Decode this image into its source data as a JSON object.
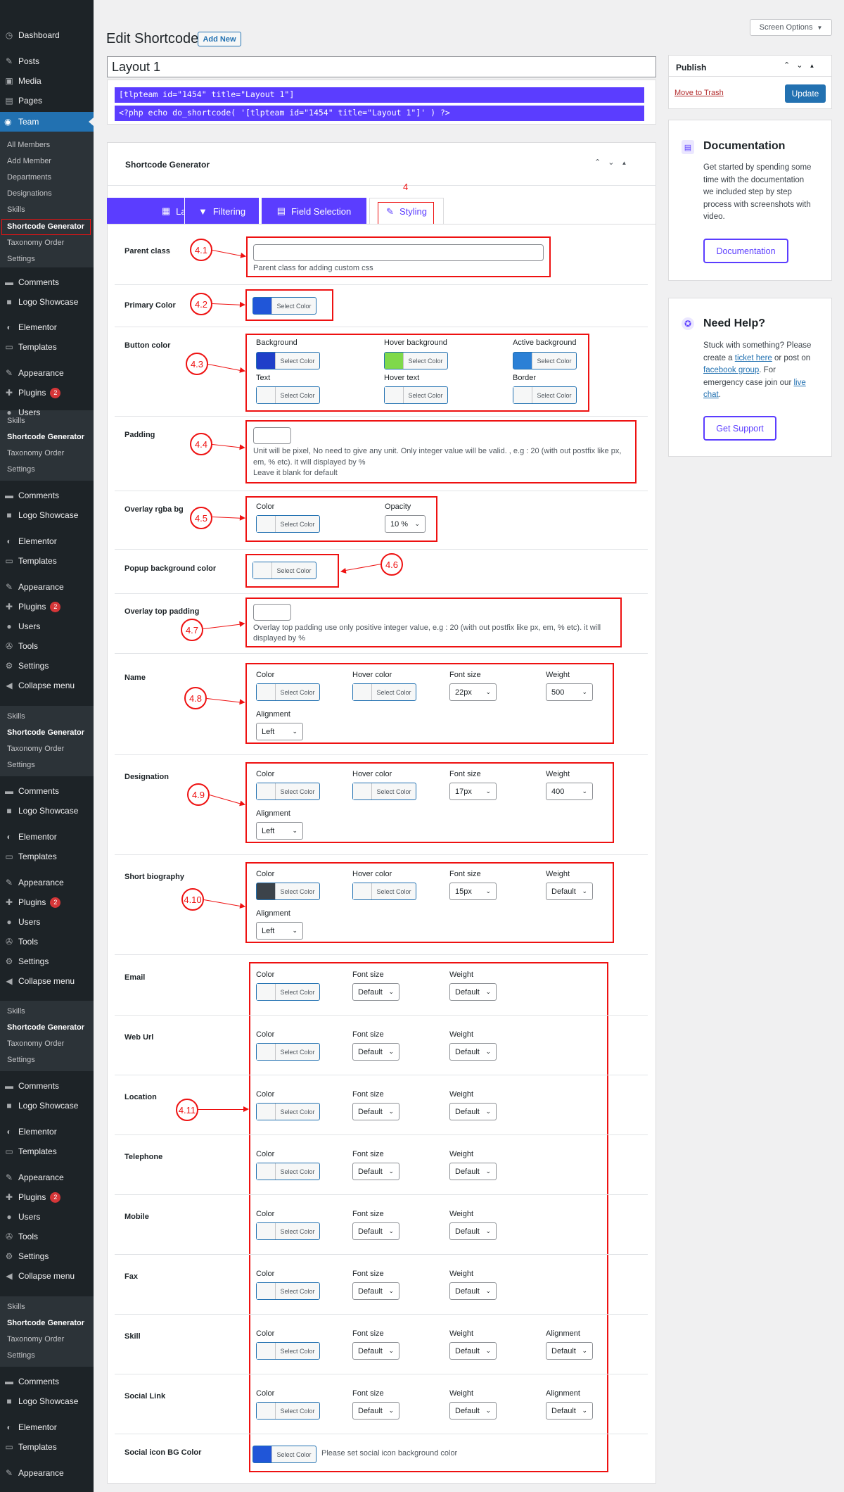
{
  "sidebar": {
    "dashboard": "Dashboard",
    "posts": "Posts",
    "media": "Media",
    "pages": "Pages",
    "team": "Team",
    "team_sub": [
      "All Members",
      "Add Member",
      "Departments",
      "Designations",
      "Skills",
      "Shortcode Generator",
      "Taxonomy Order",
      "Settings"
    ],
    "repeat_sub": [
      "Skills",
      "Shortcode Generator",
      "Taxonomy Order",
      "Settings"
    ],
    "comments": "Comments",
    "logo_showcase": "Logo Showcase",
    "elementor": "Elementor",
    "templates": "Templates",
    "appearance": "Appearance",
    "plugins": "Plugins",
    "plugins_badge": "2",
    "users": "Users",
    "tools": "Tools",
    "settings": "Settings",
    "collapse": "Collapse menu"
  },
  "header": {
    "title": "Edit Shortcode",
    "add_new": "Add New",
    "screen_options": "Screen Options"
  },
  "post_title": "Layout 1",
  "shortcodes": [
    "[tlpteam id=\"1454\" title=\"Layout 1\"]",
    "<?php echo do_shortcode( '[tlpteam id=\"1454\" title=\"Layout 1\"]' ) ?>"
  ],
  "generator": {
    "title": "Shortcode Generator",
    "tabs": [
      "Layout",
      "Filtering",
      "Field Selection",
      "Styling"
    ],
    "tab_callout": "4"
  },
  "color_btn": "Select Color",
  "fields": {
    "parent_class": {
      "label": "Parent class",
      "placeholder": "",
      "help": "Parent class for adding custom css",
      "callout": "4.1"
    },
    "primary_color": {
      "label": "Primary Color",
      "callout": "4.2",
      "swatch": "#2056d8"
    },
    "button_color": {
      "label": "Button color",
      "callout": "4.3",
      "items": [
        {
          "name": "Background",
          "swatch": "#1f3fc9"
        },
        {
          "name": "Hover background",
          "swatch": "#7fd94a"
        },
        {
          "name": "Active background",
          "swatch": "#2b80d6"
        },
        {
          "name": "Text",
          "swatch": ""
        },
        {
          "name": "Hover text",
          "swatch": ""
        },
        {
          "name": "Border",
          "swatch": ""
        }
      ]
    },
    "padding": {
      "label": "Padding",
      "callout": "4.4",
      "help": [
        "Unit will be pixel, No need to give any unit. Only integer value will be valid. , e.g : 20 (with out postfix like px,",
        "em, % etc). it will displayed by %",
        "Leave it blank for default"
      ]
    },
    "overlay": {
      "label": "Overlay rgba bg",
      "callout": "4.5",
      "color_label": "Color",
      "opacity_label": "Opacity",
      "opacity_value": "10 %"
    },
    "popup_bg": {
      "label": "Popup background color",
      "callout": "4.6"
    },
    "overlay_top": {
      "label": "Overlay top padding",
      "callout": "4.7",
      "help": [
        "Overlay top padding use only positive integer value, e.g : 20 (with out postfix like px, em, % etc). it will",
        "displayed by %"
      ]
    },
    "name": {
      "label": "Name",
      "callout": "4.8",
      "font_size": "22px",
      "weight": "500",
      "alignment": "Left"
    },
    "designation": {
      "label": "Designation",
      "callout": "4.9",
      "font_size": "17px",
      "weight": "400",
      "alignment": "Left"
    },
    "short_bio": {
      "label": "Short biography",
      "callout": "4.10",
      "font_size": "15px",
      "weight": "Default",
      "alignment": "Left",
      "swatch": "#3c434a"
    },
    "group_callout": "4.11",
    "simple_rows": [
      {
        "label": "Email",
        "align": false
      },
      {
        "label": "Web Url",
        "align": false
      },
      {
        "label": "Location",
        "align": false
      },
      {
        "label": "Telephone",
        "align": false
      },
      {
        "label": "Mobile",
        "align": false
      },
      {
        "label": "Fax",
        "align": false
      },
      {
        "label": "Skill",
        "align": true
      },
      {
        "label": "Social Link",
        "align": true
      }
    ],
    "social_icon_bg": {
      "label": "Social icon BG Color",
      "help": "Please set social icon background color",
      "swatch": "#2056d8"
    },
    "col_labels": {
      "color": "Color",
      "hover_color": "Hover color",
      "font_size": "Font size",
      "weight": "Weight",
      "alignment": "Alignment"
    },
    "default": "Default"
  },
  "publish": {
    "title": "Publish",
    "trash": "Move to Trash",
    "update": "Update"
  },
  "documentation": {
    "title": "Documentation",
    "text": [
      "Get started by spending some",
      "time with the documentation",
      "we included step by step",
      "process with screenshots with",
      "video."
    ],
    "button": "Documentation"
  },
  "need_help": {
    "title": "Need Help?",
    "line1": "Stuck with something? Please",
    "line2_pre": "create a ",
    "ticket_link": "ticket here",
    "line2_post": " or post on",
    "fb_link": "facebook group",
    "line3_post": ". For",
    "line4": "emergency case join our ",
    "chat_link": "live",
    "chat_link2": "chat",
    "line5_post": ".",
    "button": "Get Support"
  },
  "colors": {
    "accent": "#5b3dff",
    "wp_blue": "#2271b1",
    "red": "#e11111"
  }
}
